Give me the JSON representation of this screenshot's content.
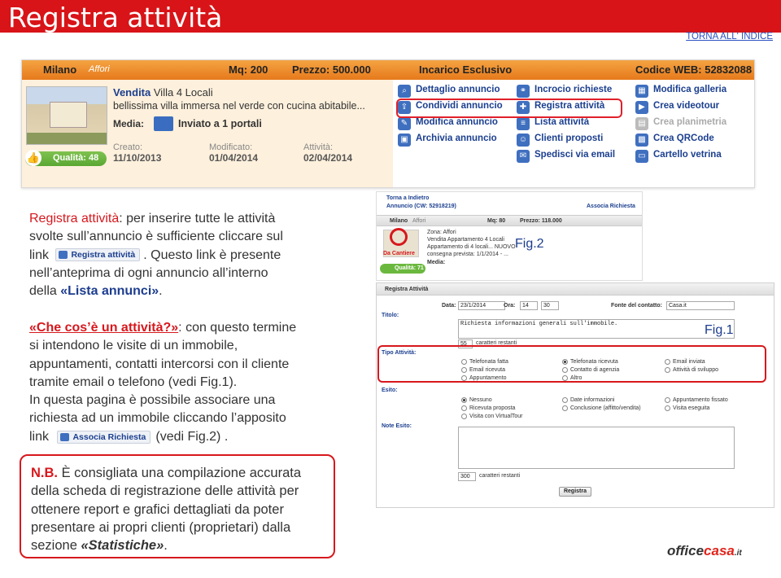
{
  "header": {
    "title": "Registra attività",
    "back_link": "TORNA ALL' INDICE"
  },
  "card": {
    "city": "Milano",
    "category": "Affori",
    "mq": "Mq: 200",
    "price": "Prezzo: 500.000",
    "mandate": "Incarico Esclusivo",
    "code": "Codice WEB: 52832088",
    "sale_type": "Vendita",
    "property": "Villa 4 Locali",
    "description": "bellissima villa immersa nel verde con cucina abitabile...",
    "media_label": "Media:",
    "sent_to": "Inviato a 1 portali",
    "quality": "Qualità: 48",
    "created_label": "Creato:",
    "created_value": "11/10/2013",
    "modified_label": "Modificato:",
    "modified_value": "01/04/2014",
    "activity_label": "Attività:",
    "activity_value": "02/04/2014",
    "menu_col1": [
      "Dettaglio annuncio",
      "Condividi annuncio",
      "Modifica annuncio",
      "Archivia annuncio"
    ],
    "menu_col2": [
      "Incrocio richieste",
      "Registra attività",
      "Lista attività",
      "Clienti proposti",
      "Spedisci via email"
    ],
    "menu_col3": [
      "Modifica galleria",
      "Crea videotour",
      "Crea planimetria",
      "Crea QRCode",
      "Cartello vetrina"
    ],
    "icons": [
      "search-icon",
      "share-icon",
      "edit-icon",
      "archive-icon",
      "people-icon",
      "register-icon",
      "list-icon",
      "clients-icon",
      "email-icon",
      "gallery-icon",
      "video-icon",
      "floorplan-icon",
      "qrcode-icon",
      "sign-icon"
    ]
  },
  "text": {
    "p1_a": "Registra attività",
    "p1_b": ": per inserire tutte le attività",
    "p1_l2": "svolte sull’annuncio è sufficiente cliccare sul",
    "p1_l3a": "link",
    "p1_btn": "Registra attività",
    "p1_l3b": ". Questo link è presente",
    "p1_l4": "nell’anteprima di ogni annuncio all’interno",
    "p1_l5a": "della ",
    "p1_l5b": "«Lista annunci»",
    "p1_l5c": ".",
    "p2_a": "«Che cos’è un attività?»",
    "p2_b": ": con questo termine",
    "p2_l2": "si intendono le visite di un immobile,",
    "p2_l3": "appuntamenti, contatti intercorsi con il cliente",
    "p2_l4": "tramite email o telefono (vedi Fig.1).",
    "p2_l5": "In questa pagina è possibile associare una",
    "p2_l6": "richiesta ad un immobile cliccando l’apposito",
    "p2_l7a": "link",
    "p2_btn": "Associa Richiesta",
    "p2_l7b": "(vedi Fig.2) ."
  },
  "nb": {
    "l1a": "N.B.",
    "l1b": "  È consigliata una compilazione accurata",
    "l2": "della scheda di registrazione delle attività per",
    "l3": "ottenere report e grafici dettagliati da poter",
    "l4": "presentare ai propri clienti (proprietari) dalla",
    "l5a": "sezione ",
    "l5b": "«Statistiche»",
    "l5c": "."
  },
  "fig2": {
    "caption": "Fig.2",
    "back": "Torna a Indietro",
    "ad": "Annuncio (CW: 52918219)",
    "assoc": "Associa Richiesta",
    "city": "Milano",
    "cat": "Affori",
    "mq": "Mq: 80",
    "price": "Prezzo: 118.000",
    "zone": "Zona: Affori",
    "sale": "Vendita  Appartamento 4 Locali",
    "desc": "Appartamento di 4 locali... NUOVO",
    "delivery": "consegna prevista: 1/1/2014 - ...",
    "media": "Media:",
    "badge": "Da Cantiere",
    "quality": "Qualità: 71"
  },
  "fig1": {
    "caption": "Fig.1",
    "header": "Registra Attività",
    "title_lbl": "Titolo:",
    "data_lbl": "Data:",
    "data_val": "23/1/2014",
    "ora_lbl": "Ora:",
    "ora_h": "14",
    "ora_m": "30",
    "fonte_lbl": "Fonte del contatto:",
    "fonte_val": "Casa.it",
    "title_val": "Richiesta informazioni generali sull'immobile.",
    "chars1": "55",
    "chars_lbl": "caratteri restanti",
    "tipo_lbl": "Tipo Attività:",
    "tipo": [
      "Telefonata fatta",
      "Email ricevuta",
      "Appuntamento",
      "Telefonata ricevuta",
      "Contatto di agenzia",
      "Altro",
      "Email inviata",
      "Attività di sviluppo"
    ],
    "esito_lbl": "Esito:",
    "esito": [
      "Nessuno",
      "Ricevuta proposta",
      "Visita con VirtualTour",
      "Date informazioni",
      "Conclusione (affitto/vendita)",
      "Appuntamento fissato",
      "Visita eseguita"
    ],
    "note_lbl": "Note Esito:",
    "chars2": "300",
    "submit": "Registra"
  },
  "logo": {
    "a": "office",
    "b": "casa",
    "c": ".it"
  }
}
